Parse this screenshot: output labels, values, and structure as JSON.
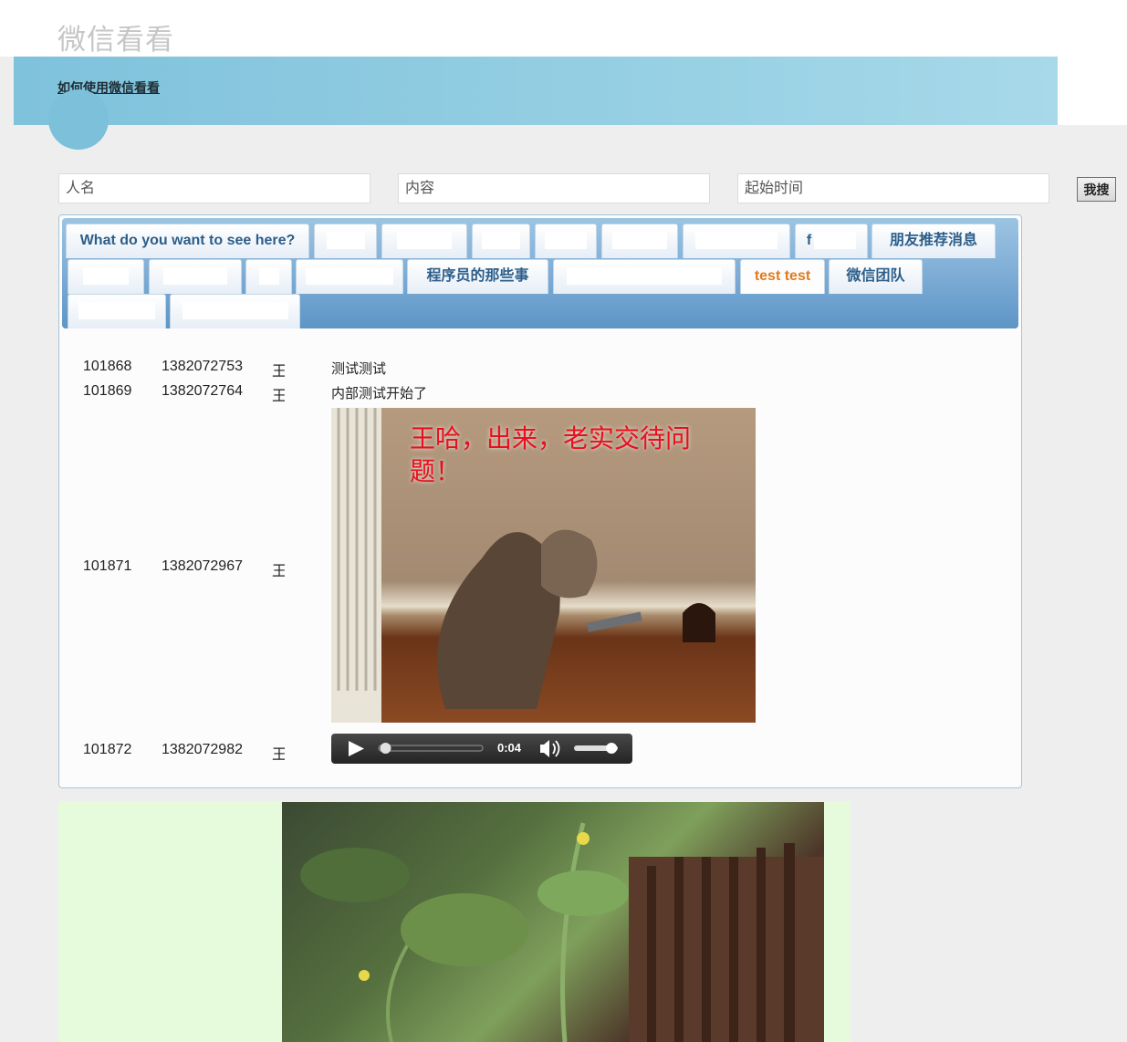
{
  "site": {
    "title": "微信看看",
    "help_link": "如何使用微信看看"
  },
  "search": {
    "name_placeholder": "人名",
    "content_placeholder": "内容",
    "time_placeholder": "起始时间",
    "button_label": "我搜"
  },
  "tabs": {
    "items": [
      {
        "label": "What do you want to see here?",
        "active": false
      },
      {
        "label": "",
        "active": false
      },
      {
        "label": "",
        "active": false
      },
      {
        "label": "",
        "active": false
      },
      {
        "label": "",
        "active": false
      },
      {
        "label": "",
        "active": false
      },
      {
        "label": "",
        "active": false
      },
      {
        "label": "f",
        "active": false
      },
      {
        "label": "朋友推荐消息",
        "active": false
      },
      {
        "label": "",
        "active": false
      },
      {
        "label": "",
        "active": false
      },
      {
        "label": "",
        "active": false
      },
      {
        "label": "",
        "active": false
      },
      {
        "label": "程序员的那些事",
        "active": false
      },
      {
        "label": "",
        "active": false
      },
      {
        "label": "test test",
        "active": true
      },
      {
        "label": "微信团队",
        "active": false
      },
      {
        "label": "",
        "active": false
      },
      {
        "label": "",
        "active": false
      }
    ]
  },
  "messages": [
    {
      "id": "101868",
      "time": "1382072753",
      "name": "王",
      "content": "测试测试"
    },
    {
      "id": "101869",
      "time": "1382072764",
      "name": "王",
      "content": "内部测试开始了"
    },
    {
      "id": "101871",
      "time": "1382072967",
      "name": "王",
      "content_image_caption": "王哈，出来，老实交待问题！"
    },
    {
      "id": "101872",
      "time": "1382072982",
      "name": "王",
      "audio_time": "0:04"
    }
  ],
  "audio_player": {
    "progress": 0.05,
    "volume": 0.85
  },
  "colors": {
    "banner": "#92cde2",
    "tab_text": "#2c5e8a",
    "active_tab_text": "#e07b1f",
    "green_area": "#e6fbdc"
  }
}
